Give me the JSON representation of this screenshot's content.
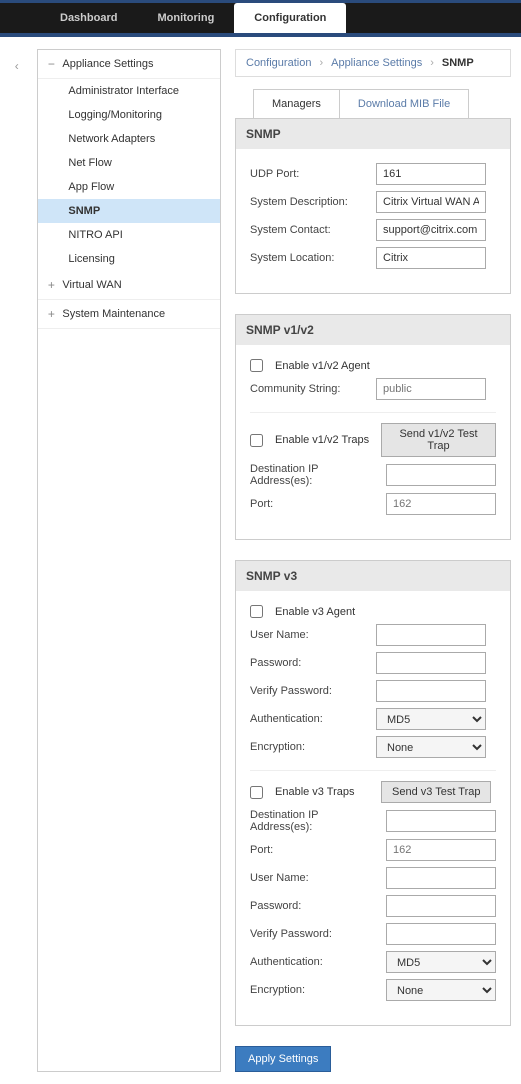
{
  "topnav": {
    "dashboard": "Dashboard",
    "monitoring": "Monitoring",
    "configuration": "Configuration"
  },
  "sidebar": {
    "group0": {
      "label": "Appliance Settings",
      "expanded": true,
      "items": [
        "Administrator Interface",
        "Logging/Monitoring",
        "Network Adapters",
        "Net Flow",
        "App Flow",
        "SNMP",
        "NITRO API",
        "Licensing"
      ]
    },
    "group1": {
      "label": "Virtual WAN"
    },
    "group2": {
      "label": "System Maintenance"
    }
  },
  "breadcrumb": {
    "a": "Configuration",
    "b": "Appliance Settings",
    "c": "SNMP"
  },
  "tabs": {
    "managers": "Managers",
    "download": "Download MIB File"
  },
  "snmp": {
    "title": "SNMP",
    "udp_port_label": "UDP Port:",
    "udp_port": "161",
    "sys_desc_label": "System Description:",
    "sys_desc": "Citrix Virtual WAN Appliance",
    "sys_contact_label": "System Contact:",
    "sys_contact": "support@citrix.com",
    "sys_loc_label": "System Location:",
    "sys_loc": "Citrix"
  },
  "v1v2": {
    "title": "SNMP v1/v2",
    "enable_agent": "Enable v1/v2 Agent",
    "community_label": "Community String:",
    "community_placeholder": "public",
    "enable_traps": "Enable v1/v2 Traps",
    "send_trap_btn": "Send v1/v2 Test Trap",
    "dest_label": "Destination IP Address(es):",
    "port_label": "Port:",
    "port_placeholder": "162"
  },
  "v3": {
    "title": "SNMP v3",
    "enable_agent": "Enable v3 Agent",
    "user_label": "User Name:",
    "pass_label": "Password:",
    "verify_label": "Verify Password:",
    "auth_label": "Authentication:",
    "auth_value": "MD5",
    "enc_label": "Encryption:",
    "enc_value": "None",
    "enable_traps": "Enable v3 Traps",
    "send_trap_btn": "Send v3 Test Trap",
    "dest_label": "Destination IP Address(es):",
    "port_label": "Port:",
    "port_placeholder": "162"
  },
  "apply_btn": "Apply Settings"
}
